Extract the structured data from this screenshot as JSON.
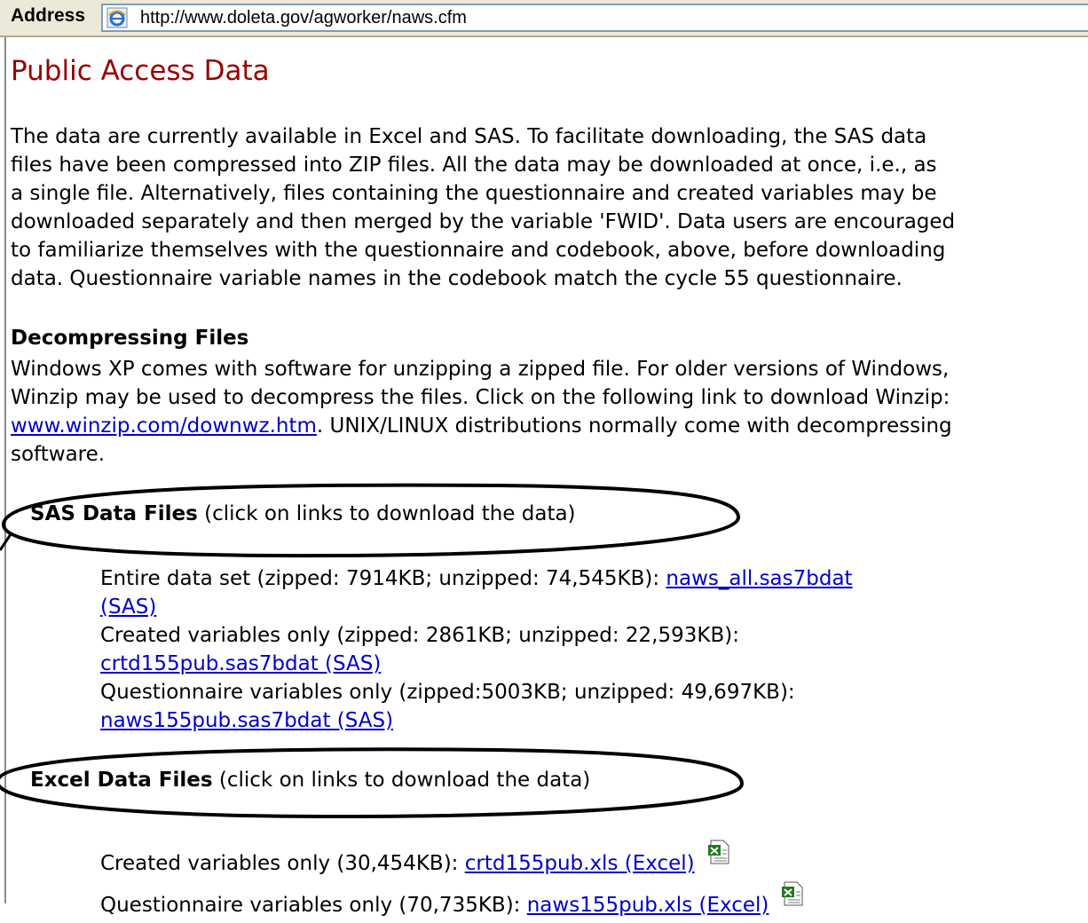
{
  "address_bar": {
    "label": "Address",
    "url": "http://www.doleta.gov/agworker/naws.cfm"
  },
  "page": {
    "title": "Public Access Data",
    "intro_lines": [
      "The data are currently available in Excel and SAS. To facilitate downloading, the SAS data",
      "files have been compressed into ZIP files. All the data may be downloaded at once, i.e., as",
      "a single file. Alternatively, files containing the questionnaire and created variables may be",
      "downloaded separately and then merged by the variable 'FWID'. Data users are encouraged",
      "to familiarize themselves with the questionnaire and codebook, above, before downloading",
      "data. Questionnaire variable names in the codebook match the cycle 55 questionnaire."
    ],
    "decompress": {
      "heading": "Decompressing Files",
      "line1": "Windows XP comes with software for unzipping a zipped file. For older versions of Windows,",
      "line2": "Winzip may be used to decompress the files. Click on the following link to download Winzip:",
      "link": "www.winzip.com/downwz.htm",
      "line3_rest": ". UNIX/LINUX distributions normally come with decompressing",
      "line4": "software."
    },
    "sas": {
      "heading_bold": "SAS Data Files",
      "heading_note": " (click on links to download the data)",
      "entire_text": "Entire data set (zipped: 7914KB; unzipped: 74,545KB): ",
      "entire_link_1": "naws_all.sas7bdat",
      "entire_link_2": "(SAS)",
      "created_text": "Created variables only (zipped: 2861KB; unzipped: 22,593KB):",
      "created_link": "crtd155pub.sas7bdat (SAS)",
      "quest_text": "Questionnaire variables only (zipped:5003KB; unzipped: 49,697KB):",
      "quest_link": "naws155pub.sas7bdat (SAS)"
    },
    "excel": {
      "heading_bold": "Excel Data Files",
      "heading_note": " (click on links to download the data)",
      "created_text": "Created variables only (30,454KB): ",
      "created_link": "crtd155pub.xls (Excel)",
      "quest_text": "Questionnaire variables only (70,735KB): ",
      "quest_link": "naws155pub.xls (Excel)"
    }
  },
  "colors": {
    "title": "#990000",
    "link": "#0000cc",
    "excel_icon": "#1e7a1e"
  }
}
